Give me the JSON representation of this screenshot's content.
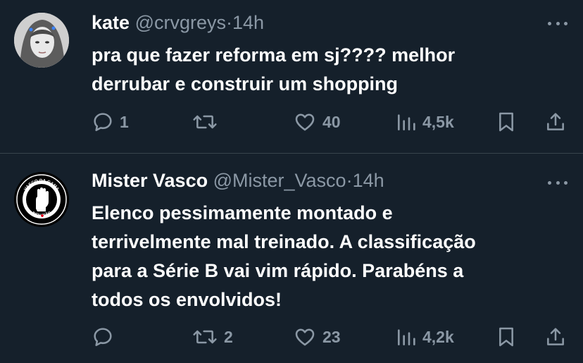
{
  "colors": {
    "background": "#15202b",
    "text": "#ffffff",
    "muted": "#8b98a5",
    "divider": "#38444d"
  },
  "tweets": [
    {
      "name": "kate",
      "handle": "@crvgreys",
      "dot": "·",
      "time": "14h",
      "text": "pra que fazer reforma em sj???? melhor\nderrubar e construir um shopping",
      "replies": "1",
      "retweets": "",
      "likes": "40",
      "views": "4,5k"
    },
    {
      "name": "Mister Vasco",
      "handle": "@Mister_Vasco",
      "dot": "·",
      "time": "14h",
      "text": "Elenco pessimamente montado e\nterrivelmente mal treinado. A classificação\npara a Série B vai vim rápido. Parabéns a\ntodos os envolvidos!",
      "replies": "",
      "retweets": "2",
      "likes": "23",
      "views": "4,2k",
      "avatar_text": {
        "top": "VASCO DA GAMA",
        "left": "RESPEITO",
        "right": "IGUALDADE",
        "bottom": "INCLUSÃO"
      }
    }
  ]
}
